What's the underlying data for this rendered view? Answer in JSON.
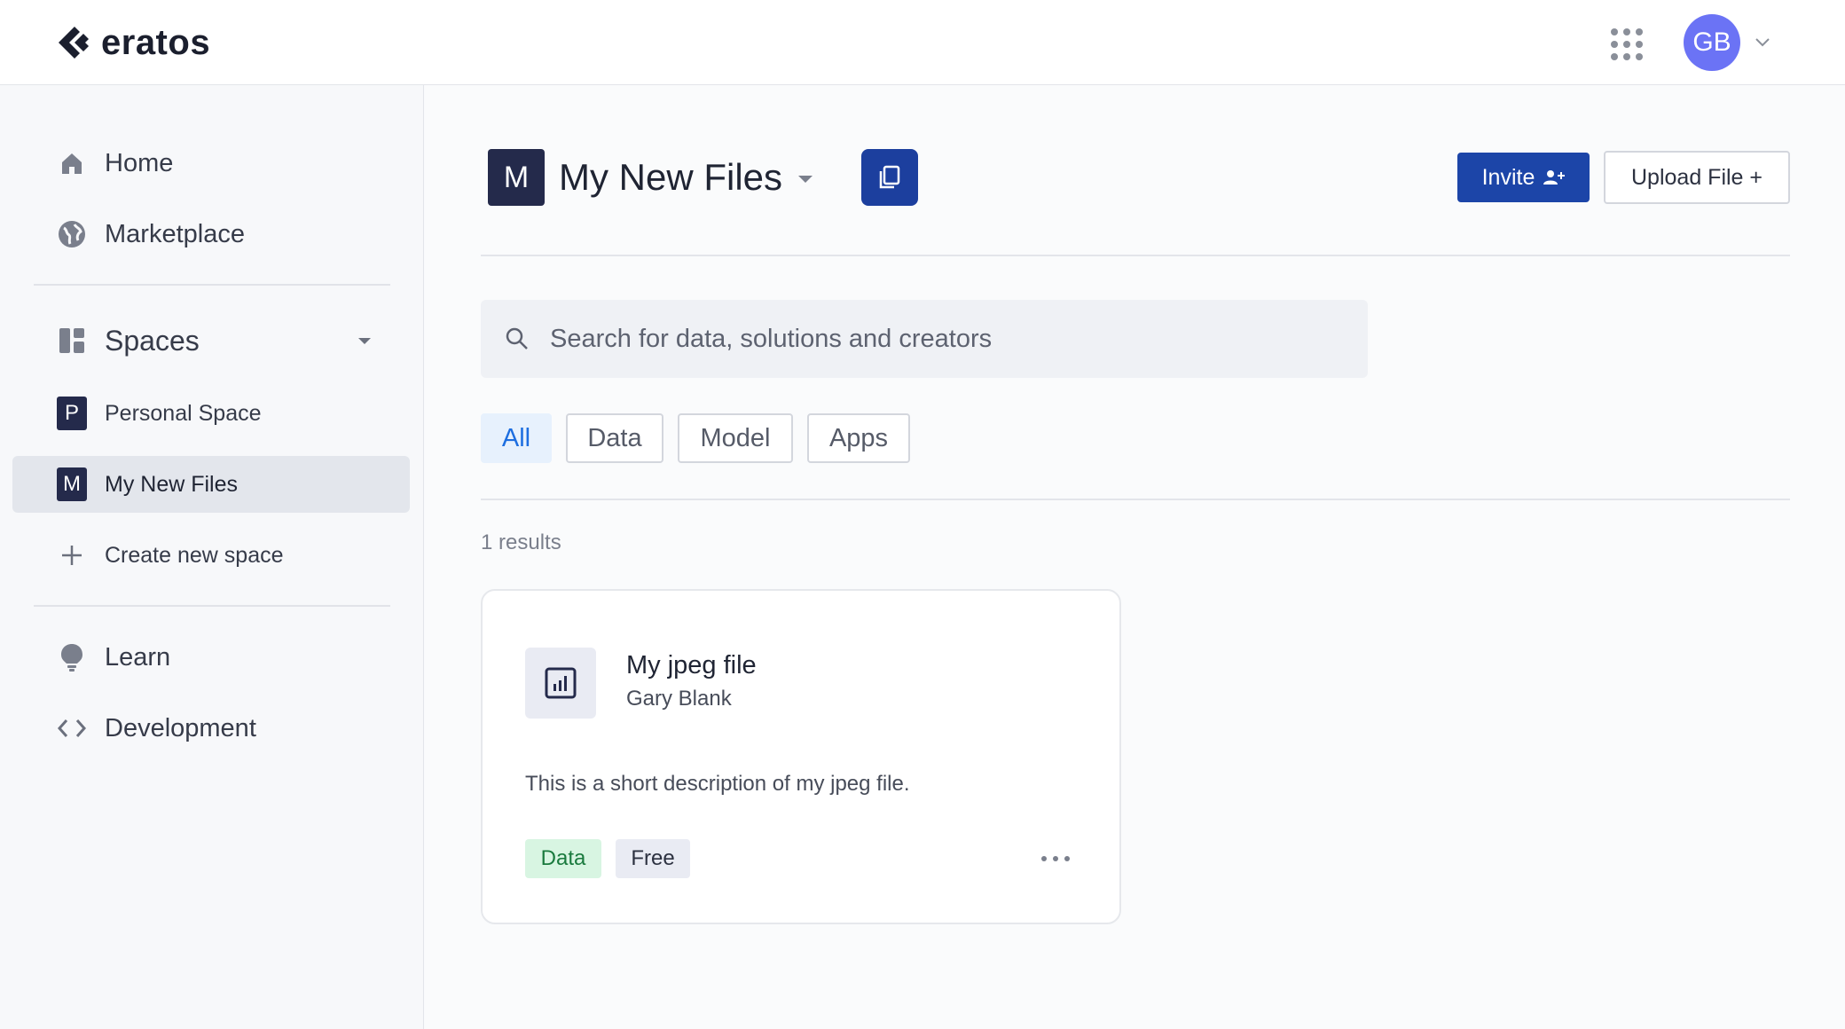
{
  "header": {
    "logo_text": "eratos",
    "avatar_initials": "GB",
    "brand_color": "#1c45a8"
  },
  "sidebar": {
    "primary": [
      {
        "label": "Home",
        "icon": "home-icon"
      },
      {
        "label": "Marketplace",
        "icon": "globe-icon"
      }
    ],
    "spaces_label": "Spaces",
    "spaces": [
      {
        "initial": "P",
        "label": "Personal Space",
        "active": false
      },
      {
        "initial": "M",
        "label": "My New Files",
        "active": true
      }
    ],
    "create_label": "Create new space",
    "secondary": [
      {
        "label": "Learn",
        "icon": "lightbulb-icon"
      },
      {
        "label": "Development",
        "icon": "code-icon"
      }
    ]
  },
  "main": {
    "space_initial": "M",
    "space_title": "My New Files",
    "invite_label": "Invite",
    "upload_label": "Upload File +",
    "search_placeholder": "Search for data, solutions and creators",
    "filters": [
      {
        "label": "All",
        "active": true
      },
      {
        "label": "Data",
        "active": false
      },
      {
        "label": "Model",
        "active": false
      },
      {
        "label": "Apps",
        "active": false
      }
    ],
    "results_text": "1 results",
    "cards": [
      {
        "title": "My jpeg file",
        "author": "Gary Blank",
        "description": "This is a short description of my jpeg file.",
        "tags": [
          "Data",
          "Free"
        ],
        "icon": "chart-file-icon"
      }
    ]
  }
}
